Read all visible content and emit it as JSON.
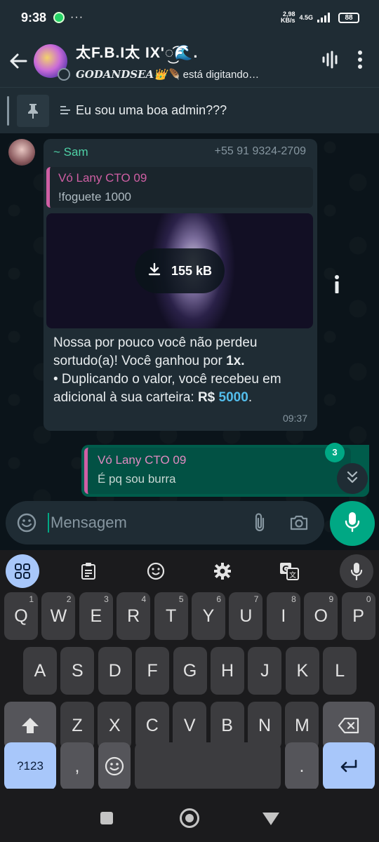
{
  "status_bar": {
    "time": "9:38",
    "dots": "···",
    "speed_top": "2,98",
    "speed_bottom": "KB/s",
    "network": "4.5G",
    "battery": "88"
  },
  "header": {
    "group_title": "太F.B.I太 IX'◌͜͡🌊.",
    "typing_user": "GODANDSEA👑🪶",
    "typing_text": "está digitando…"
  },
  "pinned": {
    "text": "Eu sou uma boa admin???"
  },
  "incoming_message": {
    "sender_name": "~ Sam",
    "sender_phone": "+55 91 9324-2709",
    "quote_author": "Vó Lany CTO 09",
    "quote_text": "!foguete 1000",
    "media_size": "155 kB",
    "text_line1": "Nossa por pouco você não perdeu sortudo(a)! Você ganhou por",
    "text_bold1": "1x.",
    "text_line2": "• Duplicando o valor, você recebeu em adicional à sua carteira:",
    "text_bold2": "R$",
    "text_amount": "5000",
    "text_end": ".",
    "time": "09:37"
  },
  "outgoing_message": {
    "quote_author": "Vó Lany CTO 09",
    "quote_text": "É pq sou burra"
  },
  "unread_count": "3",
  "composer": {
    "placeholder": "Mensagem"
  },
  "keyboard": {
    "row1": [
      {
        "key": "Q",
        "hint": "1"
      },
      {
        "key": "W",
        "hint": "2"
      },
      {
        "key": "E",
        "hint": "3"
      },
      {
        "key": "R",
        "hint": "4"
      },
      {
        "key": "T",
        "hint": "5"
      },
      {
        "key": "Y",
        "hint": "6"
      },
      {
        "key": "U",
        "hint": "7"
      },
      {
        "key": "I",
        "hint": "8"
      },
      {
        "key": "O",
        "hint": "9"
      },
      {
        "key": "P",
        "hint": "0"
      }
    ],
    "row2": [
      "A",
      "S",
      "D",
      "F",
      "G",
      "H",
      "J",
      "K",
      "L"
    ],
    "row3": [
      "Z",
      "X",
      "C",
      "V",
      "B",
      "N",
      "M"
    ],
    "symbols_key": "?123",
    "comma_key": ",",
    "period_key": "."
  },
  "colors": {
    "accent_green": "#00a884",
    "outgoing_bubble": "#005c4b",
    "quote_pink": "#cf5fa4",
    "link_blue": "#53bdeb",
    "keyboard_blue": "#a8c7fa"
  }
}
